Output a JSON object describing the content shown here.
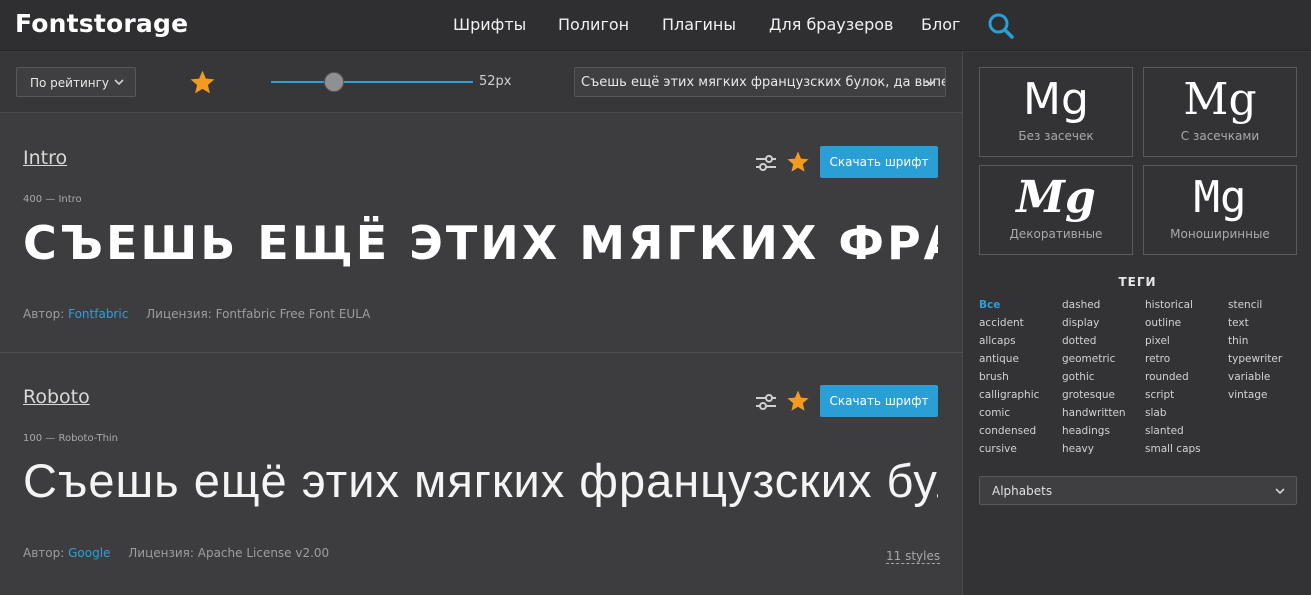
{
  "header": {
    "logo": "Fontstorage",
    "nav": [
      {
        "label": "Шрифты"
      },
      {
        "label": "Полигон"
      },
      {
        "label": "Плагины"
      },
      {
        "label": "Для браузеров"
      },
      {
        "label": "Блог"
      }
    ],
    "search_icon": "search-icon"
  },
  "toolbar": {
    "sort_value": "По рейтингу",
    "size_value": 52,
    "size_label": "52px",
    "sample_text": "Съешь ещё этих мягких французских булок, да выпей же чаю"
  },
  "fonts": [
    {
      "name": "Intro",
      "weight": "400",
      "style_name": "— Intro",
      "sample": "Съешь ещё этих мягких французских булок",
      "author_label": "Автор:",
      "author": "Fontfabric",
      "license": "Лицензия: Fontfabric Free Font EULA",
      "download_label": "Скачать шрифт"
    },
    {
      "name": "Roboto",
      "weight": "100",
      "style_name": "— Roboto-Thin",
      "sample": "Съешь ещё этих мягких французских булок",
      "author_label": "Автор:",
      "author": "Google",
      "license": "Лицензия: Apache License v2.00",
      "download_label": "Скачать шрифт",
      "styles": "11 styles"
    }
  ],
  "sidebar": {
    "categories": [
      {
        "glyph": "Mg",
        "label": "Без засечек"
      },
      {
        "glyph": "Mg",
        "label": "С засечками"
      },
      {
        "glyph": "Mg",
        "label": "Декоративные"
      },
      {
        "glyph": "Mg",
        "label": "Моноширинные"
      }
    ],
    "tags_title": "ТЕГИ",
    "tag_columns": [
      [
        "Все",
        "accident",
        "allcaps",
        "antique",
        "brush",
        "calligraphic",
        "comic",
        "condensed",
        "cursive"
      ],
      [
        "dashed",
        "display",
        "dotted",
        "geometric",
        "gothic",
        "grotesque",
        "handwritten",
        "headings",
        "heavy"
      ],
      [
        "historical",
        "outline",
        "pixel",
        "retro",
        "rounded",
        "script",
        "slab",
        "slanted",
        "small caps"
      ],
      [
        "stencil",
        "text",
        "thin",
        "typewriter",
        "variable",
        "vintage"
      ]
    ],
    "active_tag": "Все",
    "alphabet_value": "Alphabets"
  },
  "colors": {
    "accent": "#2a9fd6",
    "star": "#f39a1f",
    "header_bg": "#2f2f31",
    "main_bg": "#3d3d3f"
  }
}
